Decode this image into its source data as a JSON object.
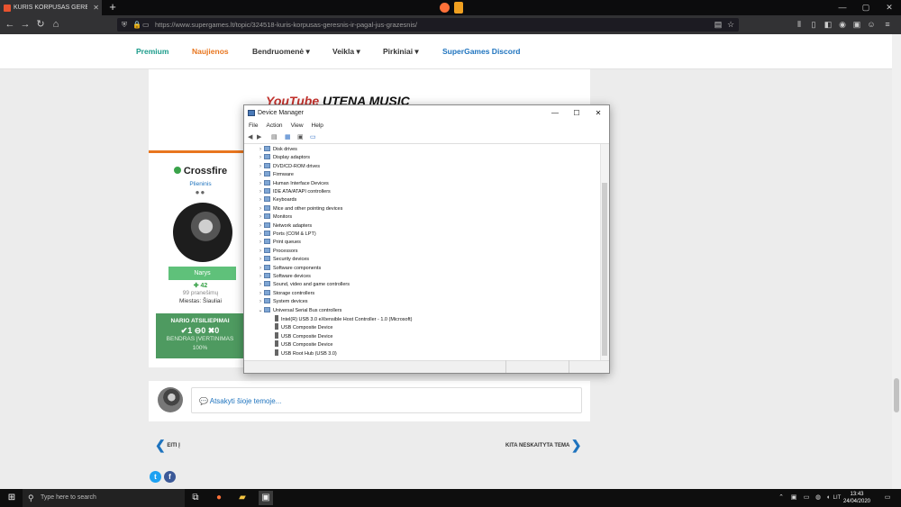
{
  "browser": {
    "tab_title": "KURIS KORPUSAS GERESNIS IR",
    "tab_close": "✕",
    "new_tab": "+",
    "url": "https://www.supergames.lt/topic/324518-kuris-korpusas-geresnis-ir-pagal-jus-grazesnis/",
    "window_controls": [
      "—",
      "▢",
      "✕"
    ],
    "nav": {
      "back": "←",
      "forward": "→",
      "reload": "↻",
      "home": "⌂"
    }
  },
  "site_nav": {
    "items": [
      {
        "label": "Premium",
        "color": "#1a9b8a"
      },
      {
        "label": "Naujienos",
        "color": "#e8761f"
      },
      {
        "label": "Bendruomenė ▾",
        "color": "#333333"
      },
      {
        "label": "Veikla ▾",
        "color": "#333333"
      },
      {
        "label": "Pirkiniai ▾",
        "color": "#333333"
      },
      {
        "label": "SuperGames Discord",
        "color": "#1e73be"
      }
    ]
  },
  "ad": {
    "youtube": "YouTube",
    "music": " UTENA MUSIC"
  },
  "author": {
    "name": "Crossfire",
    "rank": "Plieninis",
    "pips": "●●",
    "badge": "Narys",
    "reputation": "✚ 42",
    "posts": "99 pranešimų",
    "city": "Miestas: Šiauliai",
    "feedback_title": "NARIO ATSILIEPIMAI",
    "feedback_counts": "✔1 ⊖0 ✖0",
    "feedback_overall": "BENDRAS ĮVERTINIMAS",
    "feedback_percent": "100%"
  },
  "reply": {
    "placeholder": "💬 Atsakyti šioje temoje..."
  },
  "pager": {
    "prev": "EITI Į",
    "next": "KITA NESKAITYTA TEMA"
  },
  "device_manager": {
    "title": "Device Manager",
    "menu": [
      "File",
      "Action",
      "View",
      "Help"
    ],
    "window_controls": [
      "—",
      "☐",
      "✕"
    ],
    "tree": [
      {
        "label": "Disk drives",
        "expanded": false
      },
      {
        "label": "Display adaptors",
        "expanded": false
      },
      {
        "label": "DVD/CD-ROM drives",
        "expanded": false
      },
      {
        "label": "Firmware",
        "expanded": false
      },
      {
        "label": "Human Interface Devices",
        "expanded": false
      },
      {
        "label": "IDE ATA/ATAPI controllers",
        "expanded": false
      },
      {
        "label": "Keyboards",
        "expanded": false
      },
      {
        "label": "Mice and other pointing devices",
        "expanded": false
      },
      {
        "label": "Monitors",
        "expanded": false
      },
      {
        "label": "Network adapters",
        "expanded": false
      },
      {
        "label": "Ports (COM & LPT)",
        "expanded": false
      },
      {
        "label": "Print queues",
        "expanded": false
      },
      {
        "label": "Processors",
        "expanded": false
      },
      {
        "label": "Security devices",
        "expanded": false
      },
      {
        "label": "Software components",
        "expanded": false
      },
      {
        "label": "Software devices",
        "expanded": false
      },
      {
        "label": "Sound, video and game controllers",
        "expanded": false
      },
      {
        "label": "Storage controllers",
        "expanded": false
      },
      {
        "label": "System devices",
        "expanded": false
      },
      {
        "label": "Universal Serial Bus controllers",
        "expanded": true
      }
    ],
    "usb_children": [
      "Intel(R) USB 3.0 eXtensible Host Controller - 1.0 (Microsoft)",
      "USB Composite Device",
      "USB Composite Device",
      "USB Composite Device",
      "USB Root Hub (USB 3.0)"
    ]
  },
  "taskbar": {
    "search_placeholder": "Type here to search",
    "language": "LIT",
    "time": "13:43",
    "date": "24/04/2020"
  },
  "colors": {
    "accent_orange": "#e8761f",
    "online_green": "#3aa34a",
    "link_blue": "#1e73be"
  }
}
